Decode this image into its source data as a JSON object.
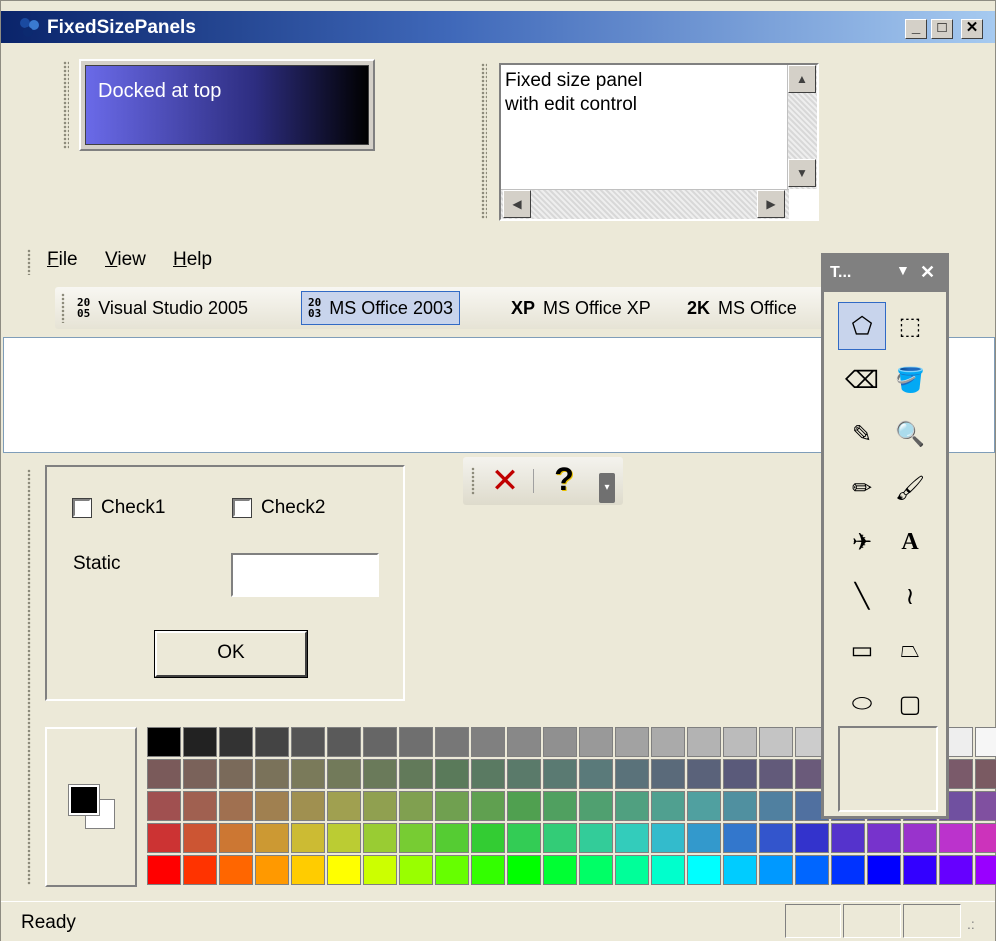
{
  "window": {
    "title": "FixedSizePanels",
    "caption_buttons": [
      "_",
      "□",
      "✕"
    ]
  },
  "top_panel": {
    "label": "Docked at top"
  },
  "edit_panel": {
    "text": "Fixed size panel\nwith edit control"
  },
  "menu": {
    "items": [
      {
        "label": "File",
        "mnemonic": "F",
        "rest": "ile"
      },
      {
        "label": "View",
        "mnemonic": "V",
        "rest": "iew"
      },
      {
        "label": "Help",
        "mnemonic": "H",
        "rest": "elp"
      }
    ]
  },
  "style_toolbar": {
    "items": [
      {
        "tag": "20\n05",
        "label": "Visual Studio 2005",
        "active": false
      },
      {
        "tag": "20\n03",
        "label": "MS Office 2003",
        "active": true
      },
      {
        "tag": "XP",
        "label": "MS Office XP",
        "active": false
      },
      {
        "tag": "2K",
        "label": "MS Office",
        "active": false
      }
    ]
  },
  "dialog": {
    "check1": "Check1",
    "check2": "Check2",
    "static_label": "Static",
    "ok_label": "OK"
  },
  "float_toolbar": {
    "delete_icon": "✕",
    "help_icon": "?"
  },
  "tools_window": {
    "title": "T...",
    "tools": [
      {
        "name": "free-select-icon",
        "glyph": "⬠",
        "selected": true
      },
      {
        "name": "rect-select-icon",
        "glyph": "⬚",
        "selected": false
      },
      {
        "name": "eraser-icon",
        "glyph": "⌫",
        "selected": false
      },
      {
        "name": "fill-bucket-icon",
        "glyph": "🪣",
        "selected": false
      },
      {
        "name": "color-picker-icon",
        "glyph": "✎",
        "selected": false
      },
      {
        "name": "magnifier-icon",
        "glyph": "🔍",
        "selected": false
      },
      {
        "name": "pencil-icon",
        "glyph": "✏",
        "selected": false
      },
      {
        "name": "brush-icon",
        "glyph": "🖌",
        "selected": false
      },
      {
        "name": "airbrush-icon",
        "glyph": "✈",
        "selected": false
      },
      {
        "name": "text-icon",
        "glyph": "A",
        "selected": false
      },
      {
        "name": "line-icon",
        "glyph": "╲",
        "selected": false
      },
      {
        "name": "curve-icon",
        "glyph": "≀",
        "selected": false
      },
      {
        "name": "rectangle-icon",
        "glyph": "▭",
        "selected": false
      },
      {
        "name": "polygon-icon",
        "glyph": "⏢",
        "selected": false
      },
      {
        "name": "ellipse-icon",
        "glyph": "⬭",
        "selected": false
      },
      {
        "name": "rounded-rect-icon",
        "glyph": "▢",
        "selected": false
      }
    ]
  },
  "palette": {
    "rows": [
      [
        "#000000",
        "#222222",
        "#333333",
        "#444444",
        "#555555",
        "#5a5a5a",
        "#666666",
        "#6f6f6f",
        "#777777",
        "#808080",
        "#888888",
        "#909090",
        "#999999",
        "#a2a2a2",
        "#aaaaaa",
        "#b3b3b3",
        "#bbbbbb",
        "#c4c4c4",
        "#cccccc",
        "#d5d5d5",
        "#dddddd",
        "#e6e6e6",
        "#eeeeee",
        "#f6f6f6"
      ],
      [
        "#7a5a5a",
        "#7a625a",
        "#7a6a5a",
        "#7a725a",
        "#7a7a5a",
        "#727a5a",
        "#6a7a5a",
        "#627a5a",
        "#5a7a5a",
        "#5a7a62",
        "#5a7a6a",
        "#5a7a72",
        "#5a7a7a",
        "#5a727a",
        "#5a6a7a",
        "#5a627a",
        "#5a5a7a",
        "#625a7a",
        "#6a5a7a",
        "#725a7a",
        "#7a5a7a",
        "#7a5a72",
        "#7a5a6a",
        "#7a5a62"
      ],
      [
        "#a05050",
        "#a06050",
        "#a07050",
        "#a08050",
        "#a09050",
        "#a0a050",
        "#90a050",
        "#80a050",
        "#70a050",
        "#60a050",
        "#50a050",
        "#50a060",
        "#50a070",
        "#50a080",
        "#50a090",
        "#50a0a0",
        "#5090a0",
        "#5080a0",
        "#5070a0",
        "#5060a0",
        "#5050a0",
        "#6050a0",
        "#7050a0",
        "#8050a0"
      ],
      [
        "#cc3333",
        "#cc5533",
        "#cc7733",
        "#cc9933",
        "#ccbb33",
        "#bbcc33",
        "#99cc33",
        "#77cc33",
        "#55cc33",
        "#33cc33",
        "#33cc55",
        "#33cc77",
        "#33cc99",
        "#33ccbb",
        "#33bbcc",
        "#3399cc",
        "#3377cc",
        "#3355cc",
        "#3333cc",
        "#5533cc",
        "#7733cc",
        "#9933cc",
        "#bb33cc",
        "#cc33bb"
      ],
      [
        "#ff0000",
        "#ff3300",
        "#ff6600",
        "#ff9900",
        "#ffcc00",
        "#ffff00",
        "#ccff00",
        "#99ff00",
        "#66ff00",
        "#33ff00",
        "#00ff00",
        "#00ff33",
        "#00ff66",
        "#00ff99",
        "#00ffcc",
        "#00ffff",
        "#00ccff",
        "#0099ff",
        "#0066ff",
        "#0033ff",
        "#0000ff",
        "#3300ff",
        "#6600ff",
        "#9900ff"
      ]
    ]
  },
  "status": {
    "text": "Ready"
  }
}
